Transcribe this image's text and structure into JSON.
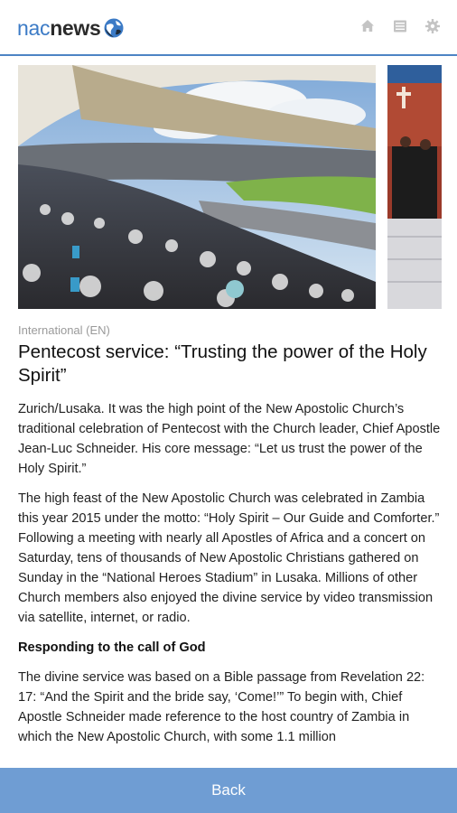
{
  "header": {
    "logo_nac": "nac",
    "logo_news": "news",
    "icons": [
      "home-icon",
      "list-icon",
      "gear-icon"
    ]
  },
  "article": {
    "category": "International (EN)",
    "title": "Pentecost service: “Trusting the power of the Holy Spirit”",
    "paragraphs": [
      "Zurich/Lusaka. It was the high point of the New Apostolic Church’s traditional celebration of Pentecost with the Church leader, Chief Apostle Jean-Luc Schneider. His core message: “Let us trust the power of the Holy Spirit.”",
      "The high feast of the New Apostolic Church was celebrated in Zambia this year 2015 under the motto: “Holy Spirit – Our Guide and Comforter.” Following a meeting with nearly all Apostles of Africa and a concert on Saturday, tens of thousands of New Apostolic Christians gathered on Sunday in the “National Heroes Stadium” in Lusaka. Millions of other Church members also enjoyed the divine service by video transmission via satellite, internet, or radio."
    ],
    "subheading": "Responding to the call of God",
    "paragraph3": "The divine service was based on a Bible passage from Revelation 22: 17: “And the Spirit and the bride say, ‘Come!’” To begin with, Chief Apostle Schneider made reference to the host country of Zambia in which the New Apostolic Church, with some 1.1 million"
  },
  "footer": {
    "back_label": "Back"
  },
  "colors": {
    "accent": "#4d84c4",
    "back_bar": "#6f9dd3"
  }
}
